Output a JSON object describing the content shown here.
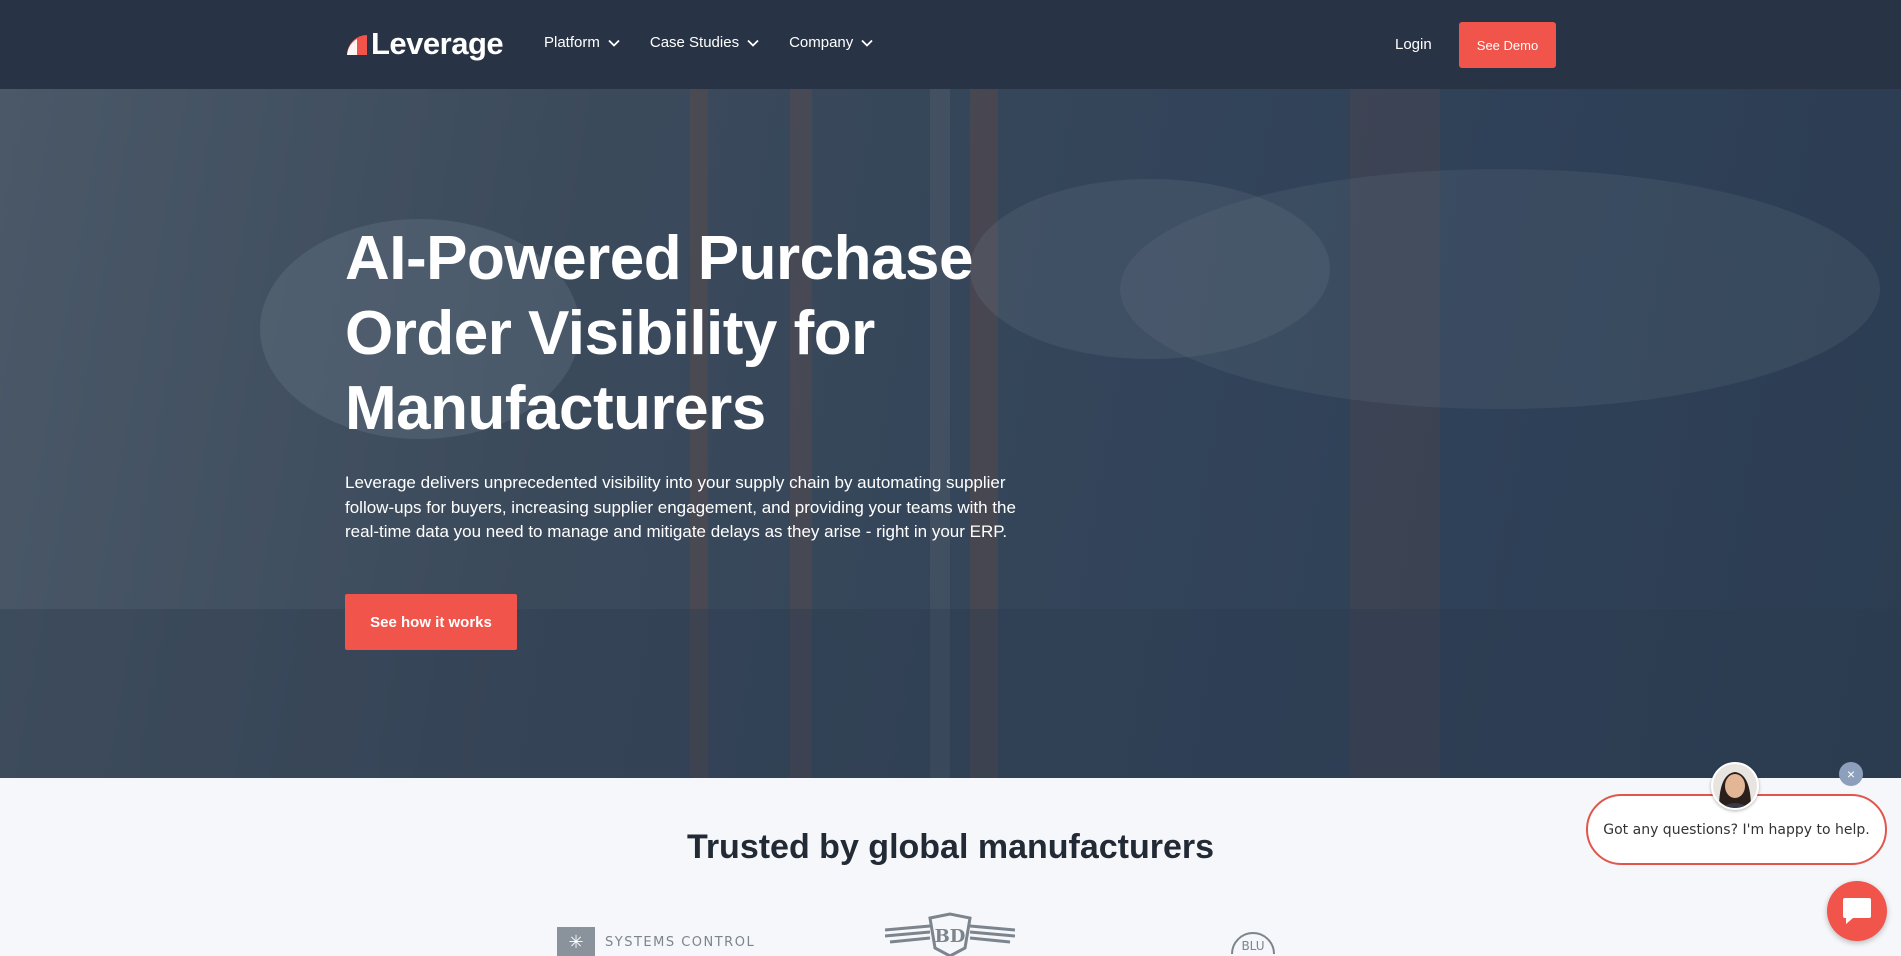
{
  "header": {
    "logo_text": "Leverage",
    "nav": [
      {
        "label": "Platform"
      },
      {
        "label": "Case Studies"
      },
      {
        "label": "Company"
      }
    ],
    "login_label": "Login",
    "demo_label": "See Demo"
  },
  "hero": {
    "title": "AI-Powered Purchase Order Visibility for Manufacturers",
    "subtitle": "Leverage delivers unprecedented visibility into your supply chain by automating supplier follow-ups for buyers, increasing supplier engagement, and providing your teams with the real-time data you need to manage and mitigate delays as they arise - right in your ERP.",
    "cta_label": "See how it works"
  },
  "trusted": {
    "title": "Trusted by global manufacturers",
    "logos": [
      {
        "name": "systems-control",
        "text": "SYSTEMS CONTROL"
      },
      {
        "name": "wings-logo",
        "text": "BD"
      },
      {
        "name": "blu-logo",
        "text": "BLU"
      }
    ]
  },
  "chat": {
    "message": "Got any questions? I'm happy to help.",
    "close_glyph": "×"
  },
  "colors": {
    "accent": "#f0544a",
    "header_bg": "#283445",
    "page_bg": "#f5f7fa"
  }
}
